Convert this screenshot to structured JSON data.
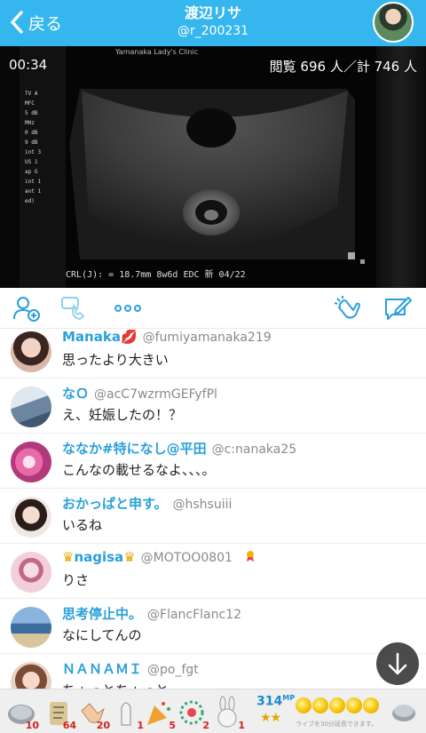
{
  "header": {
    "back_label": "戻る",
    "title": "渡辺リサ",
    "handle": "@r_200231"
  },
  "video": {
    "timer": "00:34",
    "viewers": "閲覧 696 人／計 746 人",
    "overlay_header": "Yamanaka Lady's Clinic",
    "side_readout": [
      "TV A",
      "MFC",
      "5 dB",
      "MHz",
      "0 dB",
      "9 dB",
      "int 3",
      "US 1",
      "ap G",
      "int 1",
      "ant 1",
      "",
      "ed)"
    ],
    "crl_text": "CRL(J): = 18.7mm     8w6d    EDC 新 04/22"
  },
  "comments": [
    {
      "name": "Manaka💋",
      "handle": "@fumiyamanaka219",
      "text": "思ったより大きい"
    },
    {
      "name": "なＯ",
      "handle": "@acC7wzrmGEFyfPl",
      "text": "え、妊娠したの！？"
    },
    {
      "name": "ななか#特になし@平田",
      "handle": "@c:nanaka25",
      "text": "こんなの載せるなよ、、、。"
    },
    {
      "name": "おかっぱと申す。",
      "handle": "@hshsuiii",
      "text": "いるね"
    },
    {
      "name": "nagisa",
      "handle": "@MOTOO0801",
      "text": "りさ"
    },
    {
      "name": "思考停止中。",
      "handle": "@FlancFlanc12",
      "text": "なにしてんの"
    },
    {
      "name": "ＮＡＮＡＭＩ",
      "handle": "@po_fgt",
      "text": "ちょっとちょっと"
    }
  ],
  "gifts": {
    "counts": [
      "10",
      "64",
      "20",
      "1",
      "5",
      "2",
      "1"
    ],
    "mp_value": "314",
    "mp_unit": "MP",
    "stars": "★★",
    "note": "ライブを30分延長できます。"
  }
}
